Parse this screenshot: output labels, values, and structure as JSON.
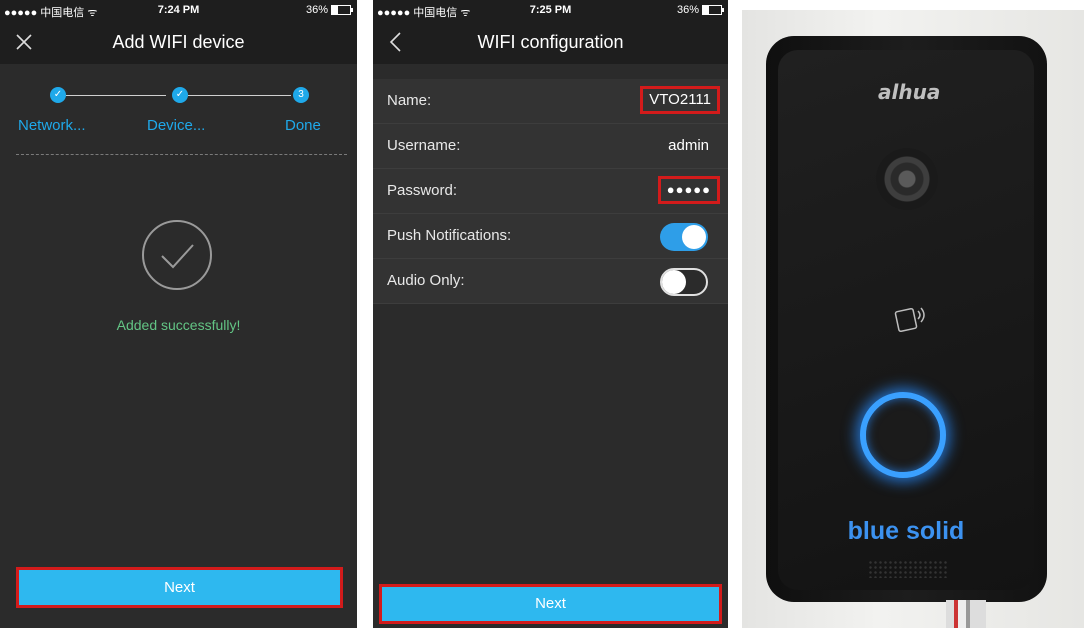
{
  "phone1": {
    "status": {
      "carrier": "●●●●● 中国电信 ᯤ",
      "time": "7:24 PM",
      "battery": "36%"
    },
    "title": "Add WIFI device",
    "steps": [
      {
        "label": "Network...",
        "mark": "✓"
      },
      {
        "label": "Device...",
        "mark": "✓"
      },
      {
        "label": "Done",
        "mark": "3"
      }
    ],
    "success_text": "Added successfully!",
    "next_label": "Next"
  },
  "phone2": {
    "status": {
      "carrier": "●●●●● 中国电信 ᯤ",
      "time": "7:25 PM",
      "battery": "36%"
    },
    "title": "WIFI configuration",
    "rows": [
      {
        "label": "Name:",
        "value": "VTO2111"
      },
      {
        "label": "Username:",
        "value": "admin"
      },
      {
        "label": "Password:",
        "value": "●●●●●"
      },
      {
        "label": "Push Notifications:",
        "toggle": "on"
      },
      {
        "label": "Audio Only:",
        "toggle": "off"
      }
    ],
    "next_label": "Next"
  },
  "photo": {
    "brand": "alhua",
    "caption": "blue solid"
  },
  "colors": {
    "accent": "#2eb8ef",
    "highlight": "#d31b1b",
    "success": "#63c585",
    "ring": "#3aa0ff"
  }
}
